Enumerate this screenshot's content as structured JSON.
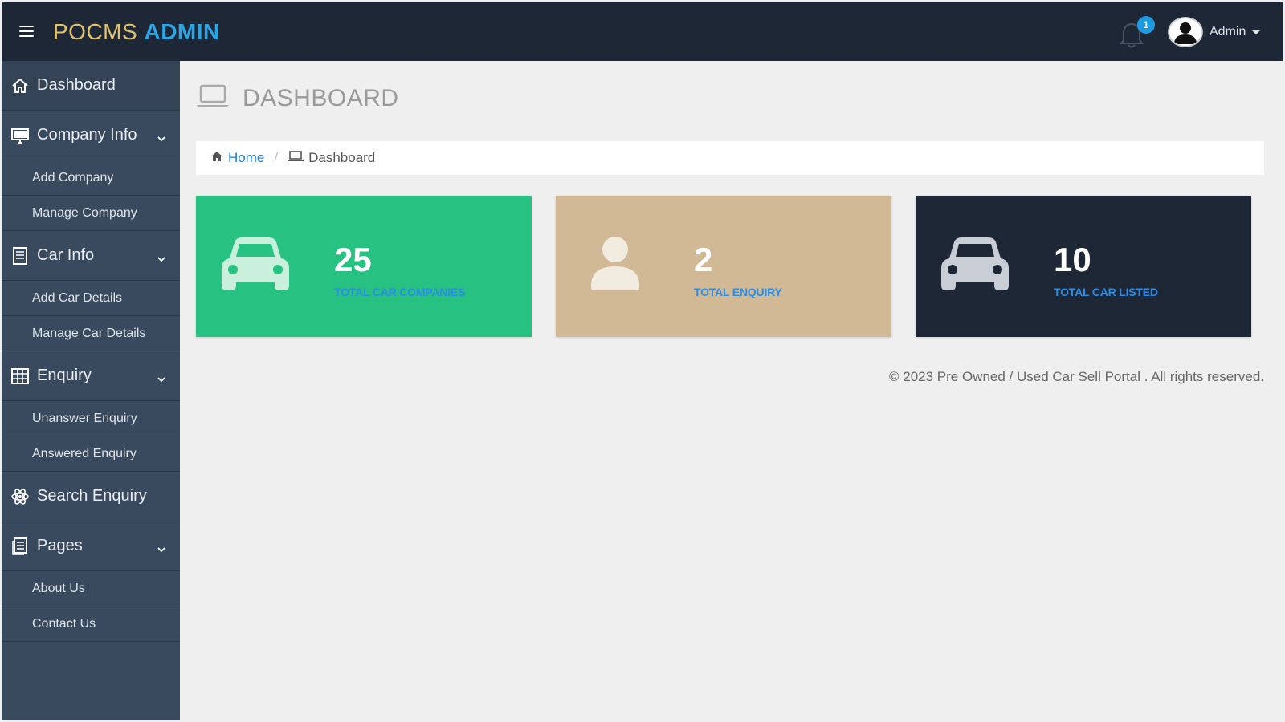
{
  "header": {
    "brand_part1": "POCMS",
    "brand_part2": "ADMIN",
    "notification_count": "1",
    "user_name": "Admin"
  },
  "sidebar": {
    "items": [
      {
        "label": "Dashboard",
        "icon": "home-icon"
      },
      {
        "label": "Company Info",
        "icon": "monitor-icon",
        "children": [
          "Add Company",
          "Manage Company"
        ]
      },
      {
        "label": "Car Info",
        "icon": "file-icon",
        "children": [
          "Add Car Details",
          "Manage Car Details"
        ]
      },
      {
        "label": "Enquiry",
        "icon": "table-icon",
        "children": [
          "Unanswer Enquiry",
          "Answered Enquiry"
        ]
      },
      {
        "label": "Search Enquiry",
        "icon": "atom-icon"
      },
      {
        "label": "Pages",
        "icon": "pages-icon",
        "children": [
          "About Us",
          "Contact Us"
        ]
      }
    ]
  },
  "page": {
    "title": "DASHBOARD",
    "breadcrumb_home": "Home",
    "breadcrumb_current": "Dashboard"
  },
  "cards": [
    {
      "value": "25",
      "caption": "TOTAL CAR COMPANIES",
      "icon": "car-icon",
      "bg": "#27c281"
    },
    {
      "value": "2",
      "caption": "TOTAL ENQUIRY",
      "icon": "user-icon",
      "bg": "#d1b995"
    },
    {
      "value": "10",
      "caption": "TOTAL CAR LISTED",
      "icon": "car-icon",
      "bg": "#1d2736"
    }
  ],
  "footer": {
    "text": "© 2023 Pre Owned / Used Car Sell Portal . All rights reserved."
  },
  "colors": {
    "topbar": "#1d2736",
    "sidebar": "#3a4a5e",
    "accent": "#2aa6e6",
    "brand_gold": "#e0c26e"
  }
}
